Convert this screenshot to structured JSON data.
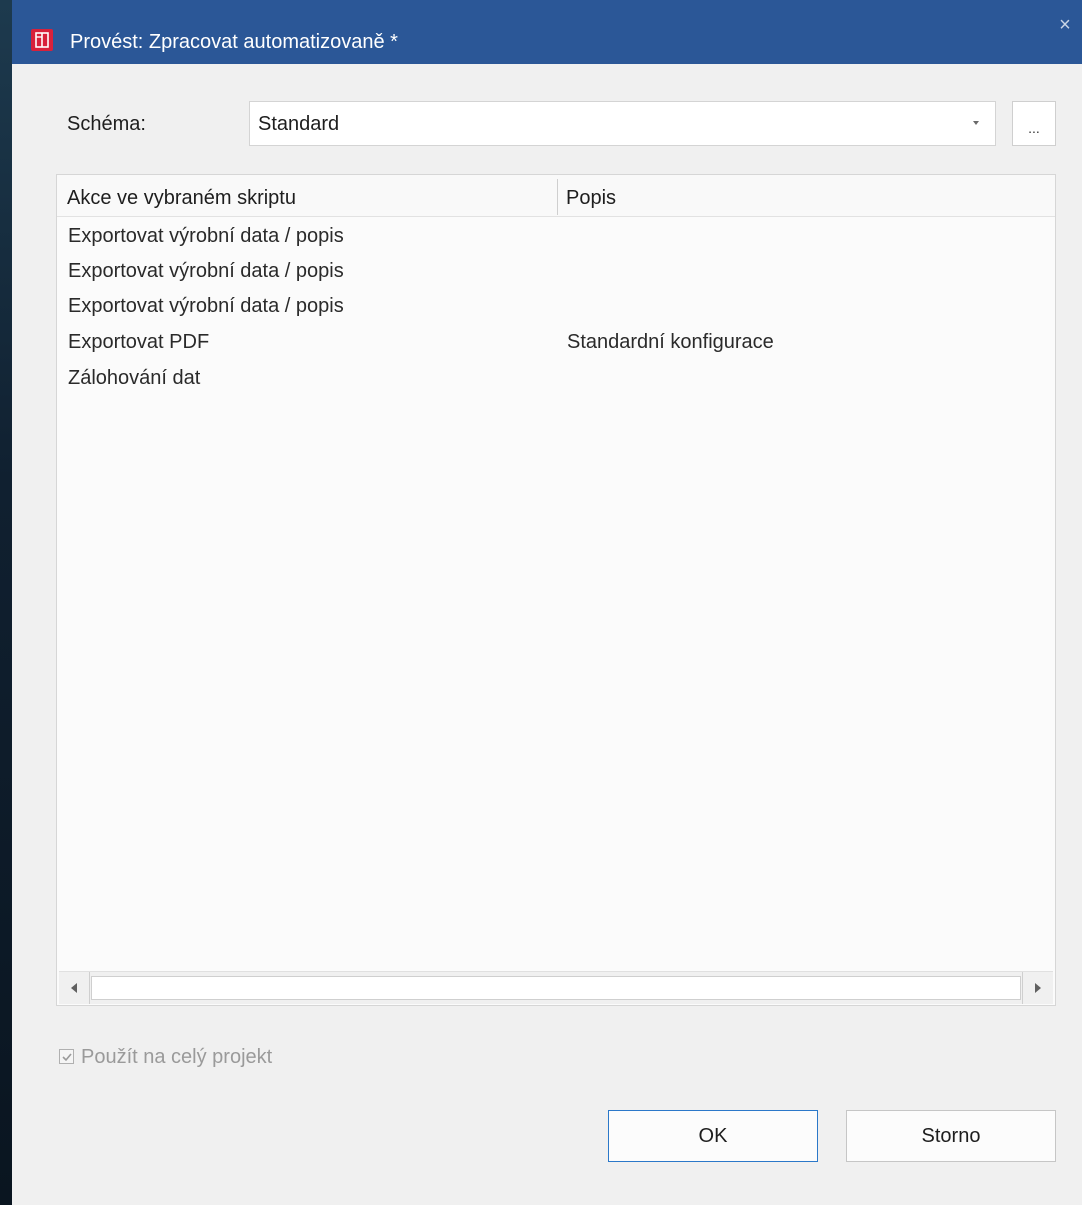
{
  "window": {
    "title": "Provést: Zpracovat automatizovaně *",
    "close_glyph": "×",
    "icon": "app-icon",
    "accent_color": "#2b5797"
  },
  "schema": {
    "label": "Schéma:",
    "value": "Standard",
    "more_label": "..."
  },
  "table": {
    "columns": [
      "Akce ve vybraném skriptu",
      "Popis"
    ],
    "rows": [
      {
        "action": "Exportovat výrobní data / popis",
        "description": ""
      },
      {
        "action": "Exportovat výrobní data / popis",
        "description": ""
      },
      {
        "action": "Exportovat výrobní data / popis",
        "description": ""
      },
      {
        "action": "Exportovat PDF",
        "description": "Standardní konfigurace"
      },
      {
        "action": "Zálohování dat",
        "description": ""
      }
    ]
  },
  "apply_whole_project": {
    "label": "Použít na celý projekt",
    "checked": true,
    "enabled": false
  },
  "buttons": {
    "ok": "OK",
    "cancel": "Storno"
  }
}
